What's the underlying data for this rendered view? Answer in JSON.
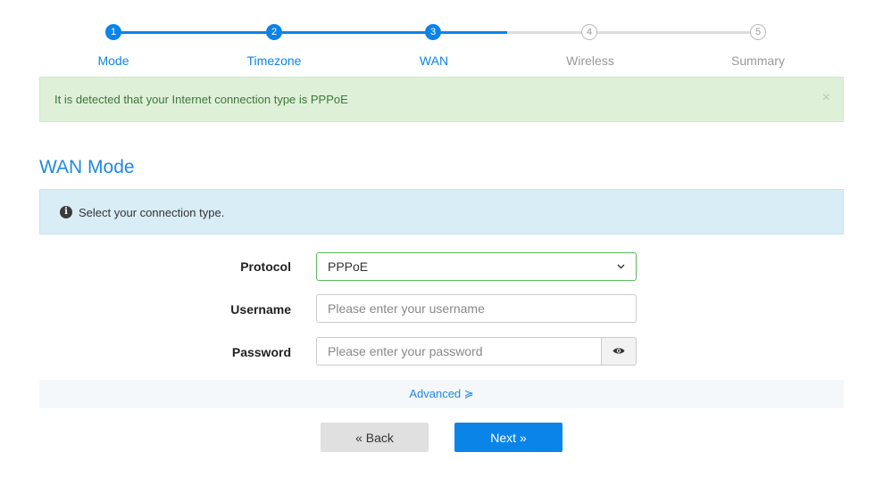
{
  "stepper": {
    "steps": [
      {
        "number": "1",
        "label": "Mode",
        "state": "done"
      },
      {
        "number": "2",
        "label": "Timezone",
        "state": "done"
      },
      {
        "number": "3",
        "label": "WAN",
        "state": "current"
      },
      {
        "number": "4",
        "label": "Wireless",
        "state": "todo"
      },
      {
        "number": "5",
        "label": "Summary",
        "state": "todo"
      }
    ]
  },
  "detect_alert": {
    "message": "It is detected that your Internet connection type is PPPoE",
    "close": "×"
  },
  "section": {
    "title": "WAN Mode"
  },
  "info_alert": {
    "icon": "i",
    "message": "Select your connection type."
  },
  "form": {
    "protocol": {
      "label": "Protocol",
      "value": "PPPoE",
      "chevron": "⌄"
    },
    "username": {
      "label": "Username",
      "value": "",
      "placeholder": "Please enter your username"
    },
    "password": {
      "label": "Password",
      "value": "",
      "placeholder": "Please enter your password",
      "toggle_icon": "eye-icon"
    }
  },
  "advanced": {
    "label": "Advanced ≽"
  },
  "buttons": {
    "back": "« Back",
    "next": "Next »"
  },
  "colors": {
    "accent": "#0b84e8",
    "success_bg": "#dff0d8",
    "info_bg": "#d9edf7"
  }
}
